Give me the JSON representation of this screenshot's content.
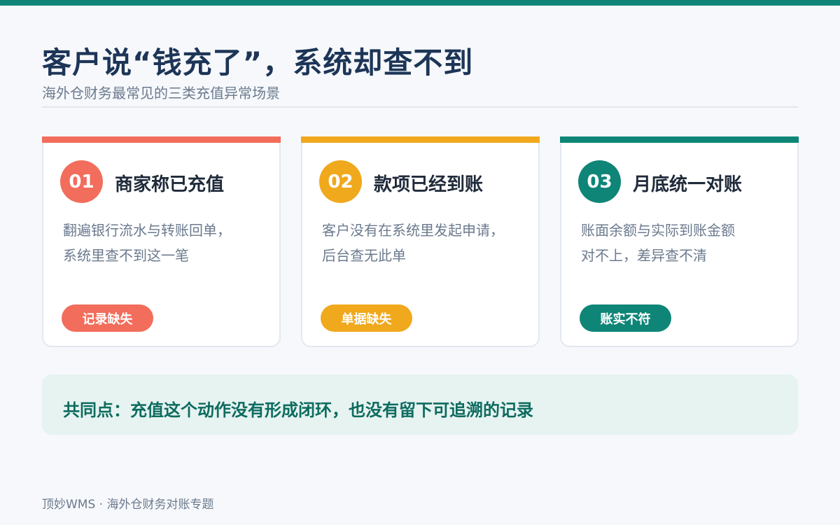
{
  "header": {
    "title": "客户说“钱充了”，系统却查不到",
    "subtitle": "海外仓财务最常见的三类充值异常场景"
  },
  "cards": [
    {
      "number": "01",
      "title": "商家称已充值",
      "desc_lines": [
        "翻遍银行流水与转账回单，",
        "系统里查不到这一笔"
      ],
      "badge": "记录缺失",
      "color": "#f26d5b"
    },
    {
      "number": "02",
      "title": "款项已经到账",
      "desc_lines": [
        "客户没有在系统里发起申请，",
        "后台查无此单"
      ],
      "badge": "单据缺失",
      "color": "#f0a81c"
    },
    {
      "number": "03",
      "title": "月底统一对账",
      "desc_lines": [
        "账面余额与实际到账金额",
        "对不上，差异查不清"
      ],
      "badge": "账实不符",
      "color": "#0e8577"
    }
  ],
  "summary": {
    "text": "共同点：充值这个动作没有形成闭环，也没有留下可追溯的记录"
  },
  "footer": {
    "text": "顶妙WMS · 海外仓财务对账专题"
  },
  "colors": {
    "brand": "#0e8577",
    "title": "#1d3557",
    "summary_text": "#0d6b5f",
    "summary_bg": "#e6f3f0"
  }
}
